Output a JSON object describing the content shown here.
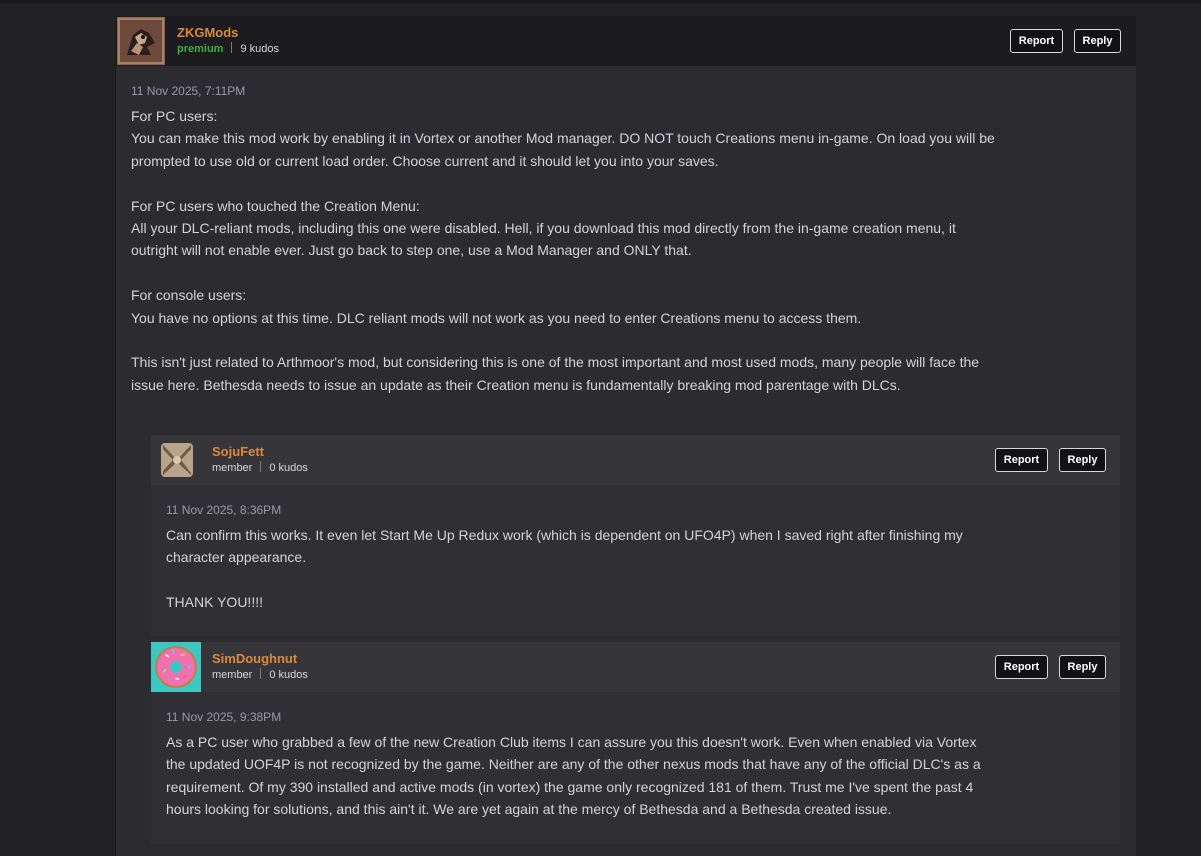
{
  "comments": [
    {
      "username": "ZKGMods",
      "role": "premium",
      "kudos": "9 kudos",
      "timestamp": "11 Nov 2025, 7:11PM",
      "report_label": "Report",
      "reply_label": "Reply",
      "paragraphs": [
        [
          "For PC users:",
          "You can make this mod work by enabling it in Vortex or another Mod manager.  DO NOT touch Creations menu in-game.  On load you will be",
          "prompted to use old or current load order.  Choose current and it should let you into your saves."
        ],
        [
          "For PC users who touched the Creation Menu:",
          "All your DLC-reliant mods, including this one were disabled.  Hell, if you download this mod directly from the in-game creation menu, it",
          "outright will not enable ever.  Just go back to step one, use a Mod Manager and ONLY that."
        ],
        [
          "For console users:",
          "You have no options at this time.  DLC reliant mods will not work as you need to enter Creations menu to access them."
        ],
        [
          "This isn't just related to Arthmoor's mod, but considering this is one of the most important and most used mods, many people will face the",
          "issue here.  Bethesda needs to issue an update as their Creation menu is fundamentally breaking mod parentage with DLCs."
        ]
      ]
    },
    {
      "username": "SojuFett",
      "role": "member",
      "kudos": "0 kudos",
      "timestamp": "11 Nov 2025, 8:36PM",
      "report_label": "Report",
      "reply_label": "Reply",
      "paragraphs": [
        [
          "Can confirm this works.  It even let Start Me Up Redux work (which is dependent on UFO4P) when I saved right after finishing my",
          "character appearance."
        ],
        [
          "THANK YOU!!!!"
        ]
      ]
    },
    {
      "username": "SimDoughnut",
      "role": "member",
      "kudos": "0 kudos",
      "timestamp": "11 Nov 2025, 9:38PM",
      "report_label": "Report",
      "reply_label": "Reply",
      "paragraphs": [
        [
          "As a PC user who grabbed a few of the new Creation Club items I can assure you this doesn't work.  Even when enabled via Vortex",
          "the updated UOF4P is not recognized by the game.  Neither are any of the other nexus mods that have any of the official DLC's as a",
          "requirement.  Of my 390 installed and active mods (in vortex) the game only recognized 181 of them.  Trust me I've spent the past 4",
          "hours looking for solutions, and this ain't it.   We are yet again at the mercy of Bethesda and a Bethesda created issue."
        ]
      ]
    }
  ],
  "colors": {
    "username": "#d98a3a",
    "premium": "#3cae3c",
    "background": "#222226"
  }
}
